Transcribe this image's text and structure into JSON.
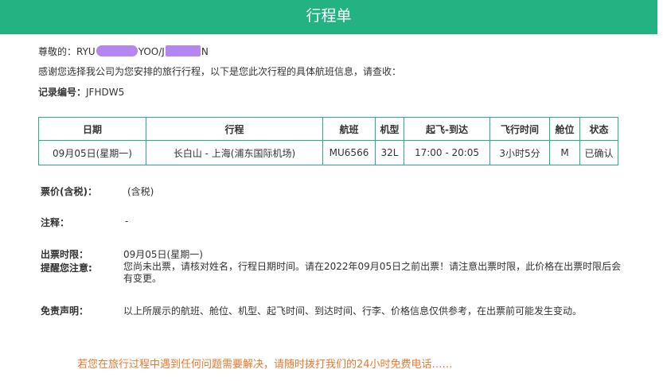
{
  "header": {
    "title": "行程单"
  },
  "greeting": {
    "prefix": "尊敬的：RYU",
    "middle": "YOO/J",
    "suffix": "N"
  },
  "intro": "感谢您选择我公司为您安排的旅行行程，以下是您此次行程的具体航班信息，请查收：",
  "record": {
    "label": "记录编号：",
    "value": "JFHDW5"
  },
  "table": {
    "headers": [
      "日期",
      "行程",
      "航班",
      "机型",
      "起飞-到达",
      "飞行时间",
      "舱位",
      "状态"
    ],
    "row": {
      "date": "09月05日(星期一)",
      "route": "长白山 - 上海(浦东国际机场)",
      "flight": "MU6566",
      "aircraft": "32L",
      "times": "17:00 - 20:05",
      "duration": "3小时5分",
      "cabin": "M",
      "status": "已确认"
    }
  },
  "price": {
    "label": "票价(含税)：",
    "value": "(含税)"
  },
  "note": {
    "label": "注释：",
    "value": "-"
  },
  "deadline": {
    "label": "出票时限：",
    "value": "09月05日(星期一)"
  },
  "reminder": {
    "label": "提醒您注意:",
    "value": "您尚未出票，请核对姓名，行程日期时间。请在2022年09月05日之前出票！请注意出票时限，此价格在出票时限后会有变更。"
  },
  "disclaimer": {
    "label": "免责声明：",
    "value": "以上所展示的航班、舱位、机型、起飞时间、到达时间、行李、价格信息仅供参考，在出票前可能发生变动。"
  },
  "footer": "若您在旅行过程中遇到任何问题需要解决，请随时拨打我们的24小时免费电话……",
  "colors": {
    "accent": "#23b383",
    "redaction": "#b487f0",
    "footer_text": "#e8792e"
  }
}
